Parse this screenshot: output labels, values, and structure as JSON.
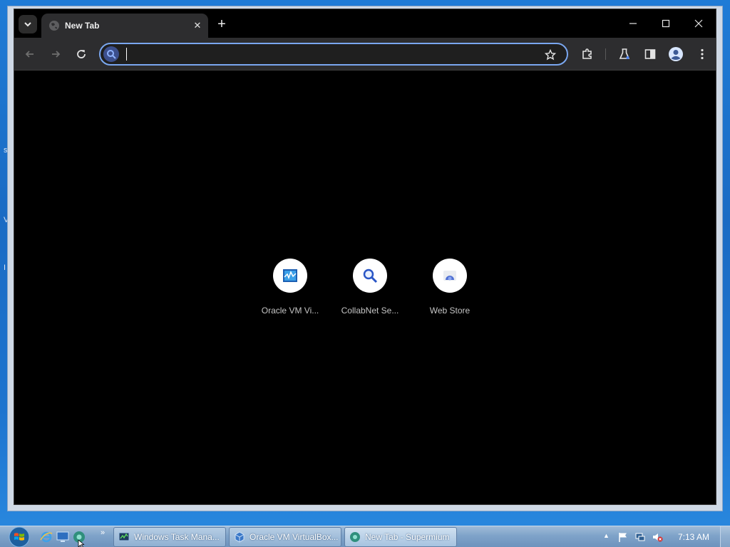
{
  "browser": {
    "tab": {
      "title": "New Tab",
      "close_glyph": "✕"
    },
    "new_tab_glyph": "+",
    "window_controls": {
      "minimize": "minimize-icon",
      "maximize": "maximize-icon",
      "close": "close-icon"
    },
    "omnibox": {
      "value": "",
      "placeholder": ""
    },
    "accent_color": "#7aa7f0"
  },
  "shortcuts": [
    {
      "label": "Oracle VM Vi...",
      "icon": "virtualbox-icon"
    },
    {
      "label": "CollabNet Se...",
      "icon": "collabnet-search-icon"
    },
    {
      "label": "Web Store",
      "icon": "webstore-icon"
    }
  ],
  "taskbar": {
    "more_glyph": "»",
    "tasks": [
      {
        "label": "Windows Task Mana...",
        "icon": "task-manager-icon"
      },
      {
        "label": "Oracle VM VirtualBox...",
        "icon": "virtualbox-icon"
      },
      {
        "label": "New Tab - Supermium",
        "icon": "supermium-icon"
      }
    ],
    "tray_arrow": "▲",
    "clock": "7:13 AM"
  },
  "desktop_fragments": [
    "s",
    "V",
    "I"
  ]
}
